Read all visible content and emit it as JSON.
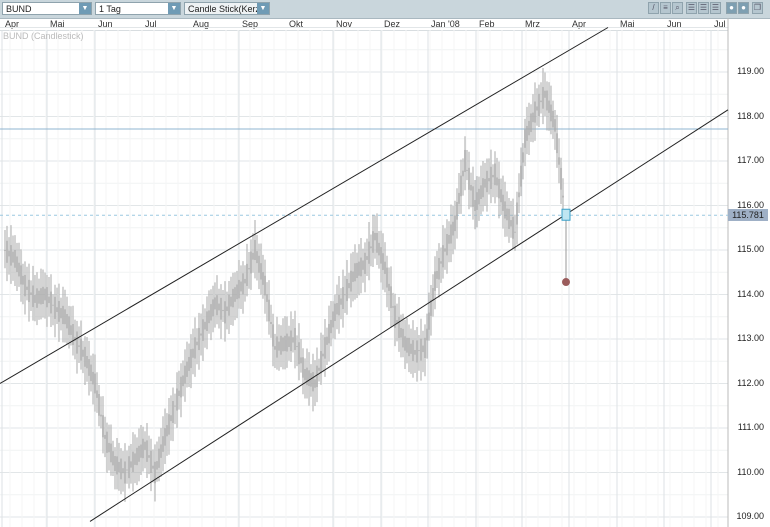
{
  "toolbar": {
    "symbol": "BUND",
    "period": "1 Tag",
    "chart_type": "Candle Stick(Kerze",
    "tools": [
      "pen-icon",
      "lines-icon",
      "zoom-icon",
      "grid-1-icon",
      "grid-2-icon",
      "grid-3-icon",
      "settings-icon",
      "print-icon",
      "window-icon"
    ]
  },
  "months": [
    "Apr",
    "Mai",
    "Jun",
    "Jul",
    "Aug",
    "Sep",
    "Okt",
    "Nov",
    "Dez",
    "Jan '08",
    "Feb",
    "Mrz",
    "Apr",
    "Mai",
    "Jun",
    "Jul"
  ],
  "chart_title": "BUND (Candlestick)",
  "colors": {
    "candle": "#aaaaaa",
    "channel": "#222222",
    "hline": "#8fb4d0",
    "marker": "#9a5b5b",
    "last": "#9fb0c6"
  },
  "chart_data": {
    "type": "candlestick",
    "ylim": [
      109,
      120
    ],
    "y_ticks": [
      "109.00",
      "110.00",
      "111.00",
      "112.00",
      "113.00",
      "114.00",
      "115.00",
      "116.00",
      "117.00",
      "118.00",
      "119.00"
    ],
    "last_price": "115.781",
    "closes": [
      115.0,
      114.8,
      114.2,
      113.9,
      114.0,
      113.7,
      113.5,
      113.0,
      112.6,
      112.0,
      110.8,
      110.2,
      110.0,
      110.3,
      110.6,
      110.0,
      110.8,
      111.5,
      112.2,
      112.8,
      113.3,
      113.8,
      113.6,
      114.0,
      114.3,
      115.0,
      114.2,
      112.8,
      112.9,
      113.0,
      112.2,
      112.0,
      112.8,
      113.6,
      114.0,
      114.5,
      114.7,
      115.3,
      114.6,
      113.5,
      112.9,
      112.7,
      112.8,
      114.3,
      115.0,
      115.6,
      117.0,
      116.0,
      116.5,
      116.7,
      115.9,
      115.4,
      117.5,
      118.1,
      118.5,
      117.8,
      115.8
    ],
    "upper_channel": [
      112.0,
      120.0
    ],
    "lower_channel": [
      108.9,
      118.15
    ],
    "horizontal_line": 117.72,
    "target_marker": 114.28
  }
}
